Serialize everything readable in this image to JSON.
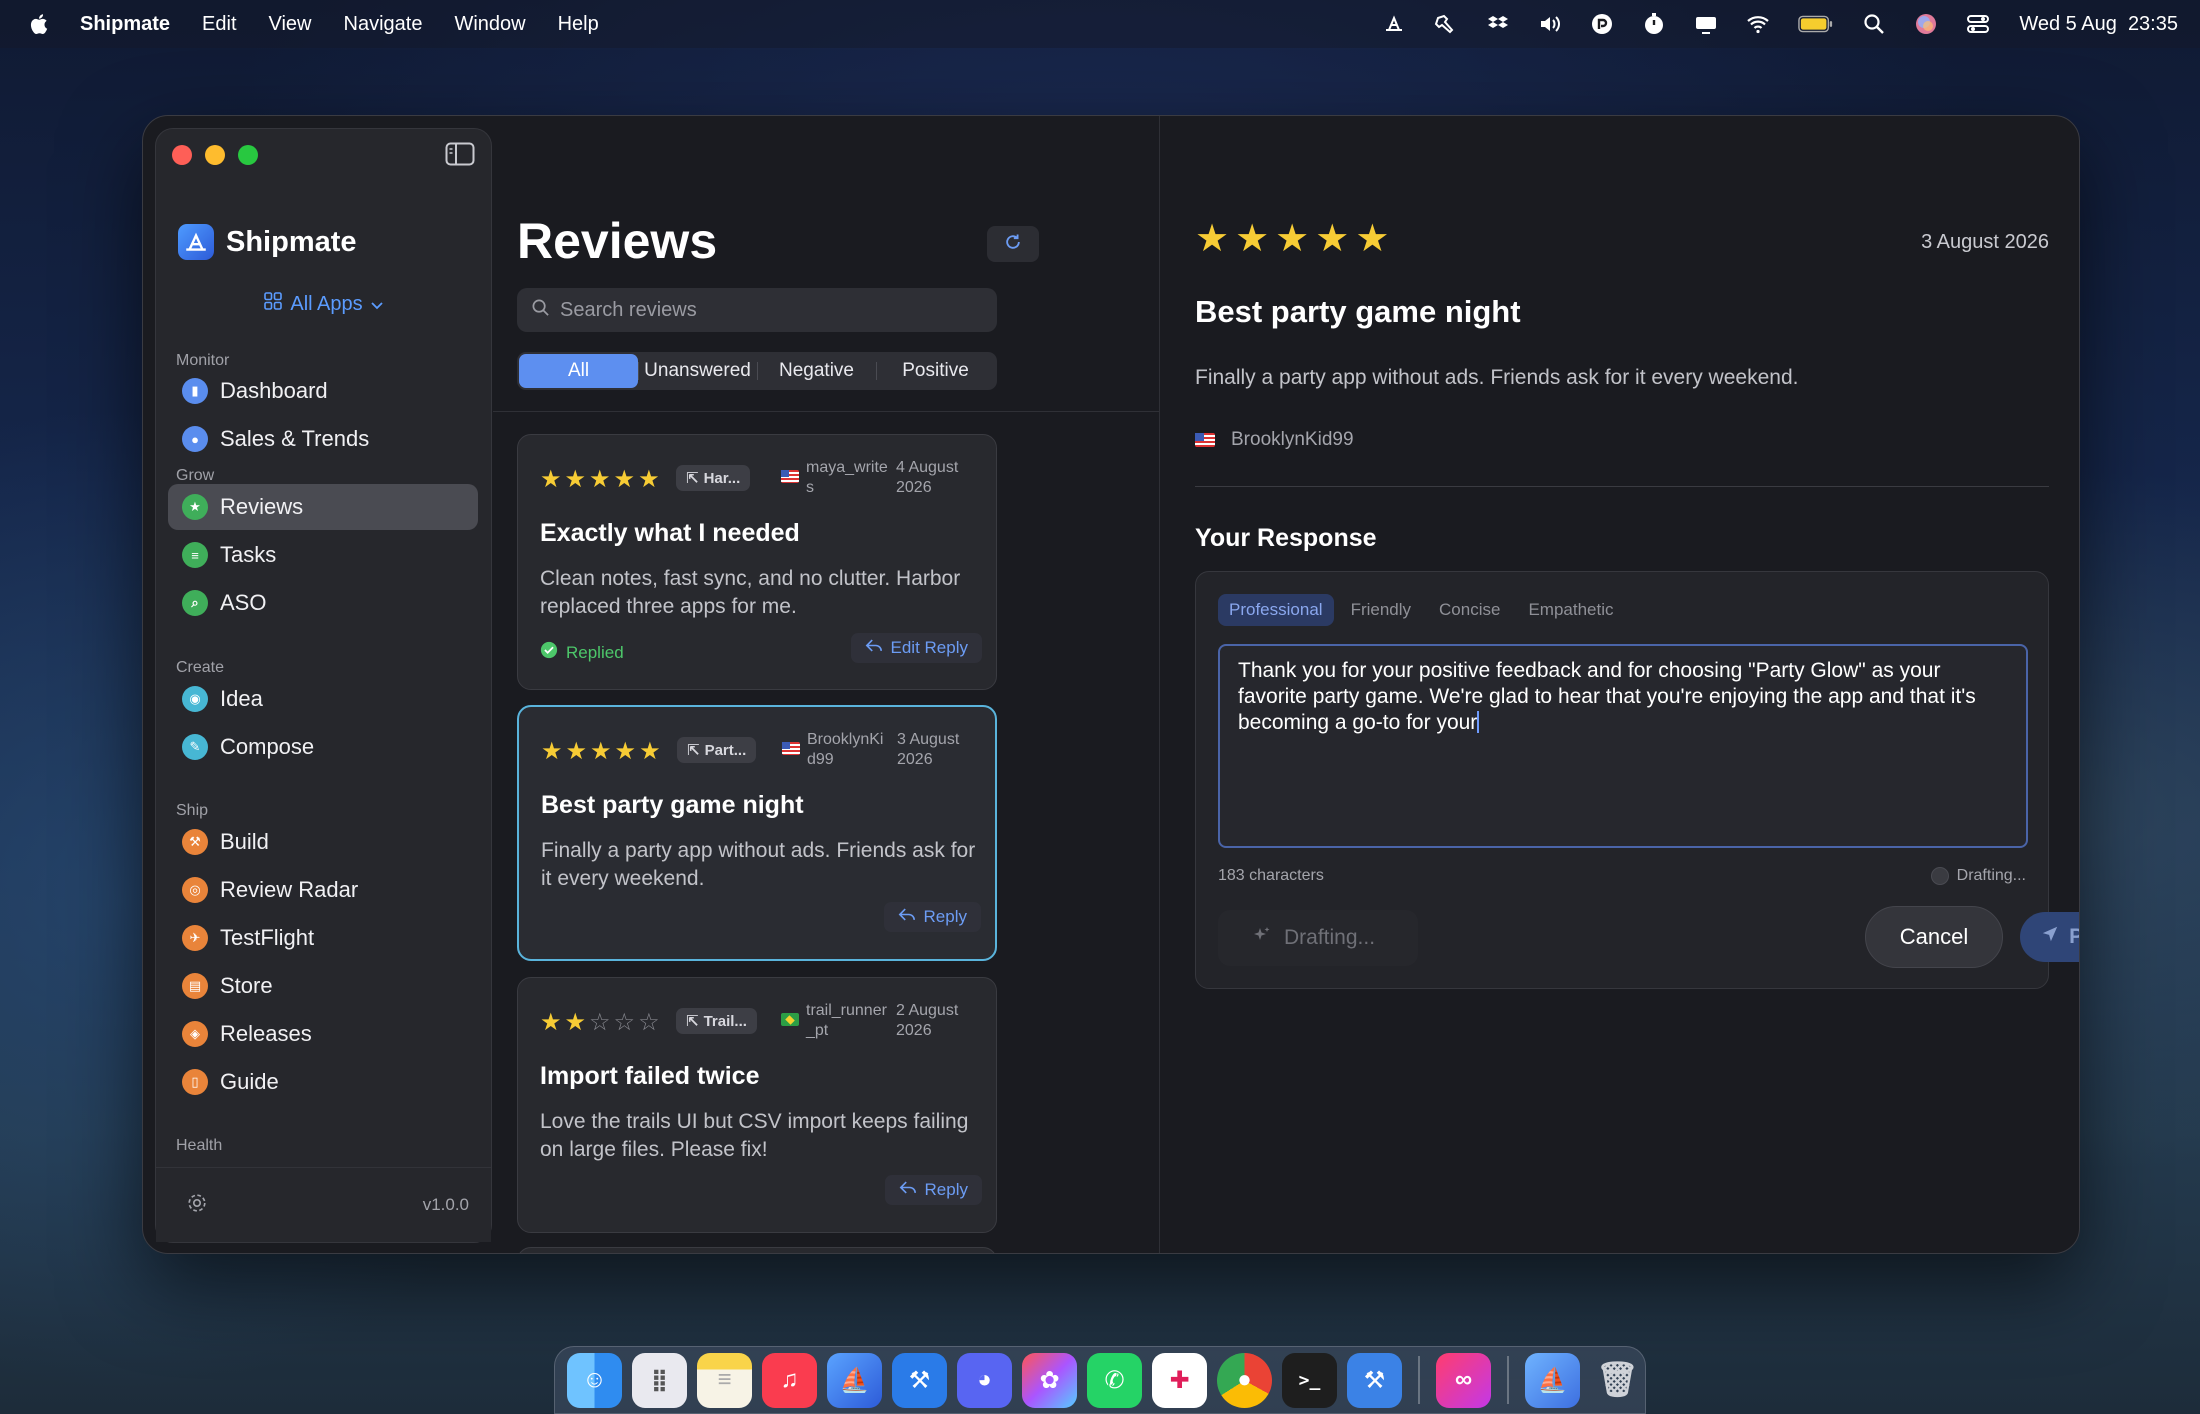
{
  "menubar": {
    "app": "Shipmate",
    "items": [
      "Edit",
      "View",
      "Navigate",
      "Window",
      "Help"
    ],
    "clock": "Wed 5 Aug  23:35"
  },
  "sidebar": {
    "brand": "Shipmate",
    "all_apps": "All Apps",
    "sections": {
      "monitor": "Monitor",
      "grow": "Grow",
      "create": "Create",
      "ship": "Ship",
      "health": "Health"
    },
    "items": {
      "dashboard": "Dashboard",
      "sales": "Sales & Trends",
      "reviews": "Reviews",
      "tasks": "Tasks",
      "aso": "ASO",
      "idea": "Idea",
      "compose": "Compose",
      "build": "Build",
      "review_radar": "Review Radar",
      "testflight": "TestFlight",
      "store": "Store",
      "releases": "Releases",
      "guide": "Guide"
    },
    "version": "v1.0.0"
  },
  "reviews_list": {
    "title": "Reviews",
    "search_placeholder": "Search reviews",
    "filters": [
      "All",
      "Unanswered",
      "Negative",
      "Positive"
    ],
    "active_filter": "All",
    "cards": [
      {
        "rating": 5,
        "app": "Har...",
        "author": "maya_writes",
        "date": "4 August 2026",
        "title": "Exactly what I needed",
        "body": "Clean notes, fast sync, and no clutter. Harbor replaced three apps for me.",
        "status": "Replied",
        "action": "Edit Reply"
      },
      {
        "rating": 5,
        "app": "Part...",
        "author": "BrooklynKid99",
        "date": "3 August 2026",
        "title": "Best party game night",
        "body": "Finally a party app without ads. Friends ask for it every weekend.",
        "action": "Reply"
      },
      {
        "rating": 2,
        "app": "Trail...",
        "author": "trail_runner_pt",
        "date": "2 August 2026",
        "title": "Import failed twice",
        "body": "Love the trails UI but CSV import keeps failing on large files. Please fix!",
        "action": "Reply"
      }
    ]
  },
  "detail": {
    "rating": 5,
    "date": "3 August 2026",
    "title": "Best party game night",
    "body": "Finally a party app without ads. Friends ask for it every weekend.",
    "author": "BrooklynKid99",
    "response_heading": "Your Response",
    "tones": [
      "Professional",
      "Friendly",
      "Concise",
      "Empathetic"
    ],
    "active_tone": "Professional",
    "draft_text": "Thank you for your positive feedback and for choosing \"Party Glow\" as your favorite party game. We're glad to hear that you're enjoying the app and that it's becoming a go-to for your",
    "char_count": "183 characters",
    "status": "Drafting...",
    "generate_label": "Drafting...",
    "cancel_label": "Cancel",
    "publish_label": "Publish"
  },
  "colors": {
    "accent": "#5d8ff0",
    "star": "#f7cc35",
    "replied": "#4dc76a",
    "selected_border": "#5ab4dc"
  }
}
